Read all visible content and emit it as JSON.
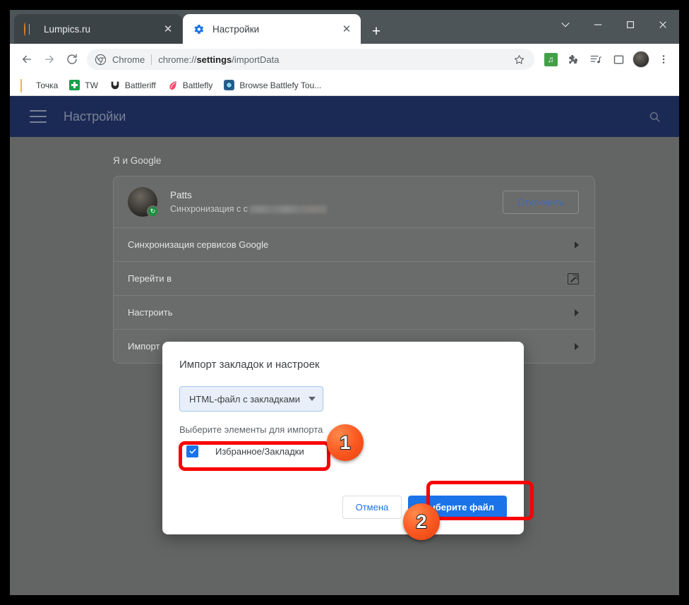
{
  "browser": {
    "tabs": [
      {
        "title": "Lumpics.ru",
        "favicon": "orange-circle-icon",
        "active": false,
        "close_label": "✕"
      },
      {
        "title": "Настройки",
        "favicon": "gear-icon",
        "active": true,
        "close_label": "✕"
      }
    ],
    "new_tab_label": "+",
    "window_controls": {
      "chevron": "⌄",
      "minimize": "—",
      "maximize": "□",
      "close": "✕"
    },
    "toolbar": {
      "back": "←",
      "forward": "→",
      "reload": "⟳",
      "omnibox": {
        "scheme_label": "Chrome",
        "url_prefix": "chrome://",
        "url_bold": "settings",
        "url_suffix": "/importData"
      },
      "star": "☆",
      "music_ext": "♫",
      "puzzle": "❖",
      "reading_list": "≡",
      "side_panel": "□",
      "menu": "⋮"
    },
    "bookmarks": [
      {
        "label": "Точка",
        "icon": "folder-icon"
      },
      {
        "label": "TW",
        "icon": "green-cross-icon"
      },
      {
        "label": "Battleriff",
        "icon": "shield-icon"
      },
      {
        "label": "Battlefly",
        "icon": "red-leaf-icon"
      },
      {
        "label": "Browse Battlefy Tou...",
        "icon": "blue-gem-icon"
      }
    ]
  },
  "settings_page": {
    "header": {
      "menu_icon": "hamburger-icon",
      "title": "Настройки",
      "search_icon": "search-icon"
    },
    "section_title": "Я и Google",
    "account": {
      "name": "Patts",
      "sync_text": "Синхронизация с с",
      "disconnect_label": "Отключить"
    },
    "rows": [
      {
        "label": "Синхронизация сервисов Google",
        "control": "chevron-right-icon"
      },
      {
        "label": "Перейти в",
        "control": "external-link-icon"
      },
      {
        "label": "Настроить",
        "control": "chevron-right-icon"
      },
      {
        "label": "Импорт за",
        "control": "chevron-right-icon"
      }
    ]
  },
  "dialog": {
    "title": "Импорт закладок и настроек",
    "source_select": {
      "value": "HTML-файл с закладками",
      "caret": "▼"
    },
    "subtitle": "Выберите элементы для импорта",
    "checkbox": {
      "label": "Избранное/Закладки",
      "checked": true,
      "mark": "✓"
    },
    "cancel_label": "Отмена",
    "confirm_label": "Выберите файл"
  },
  "annotations": {
    "badges": [
      {
        "number": "1"
      },
      {
        "number": "2"
      }
    ],
    "highlight_color": "#f80000",
    "badge_color": "#fb5b23"
  }
}
